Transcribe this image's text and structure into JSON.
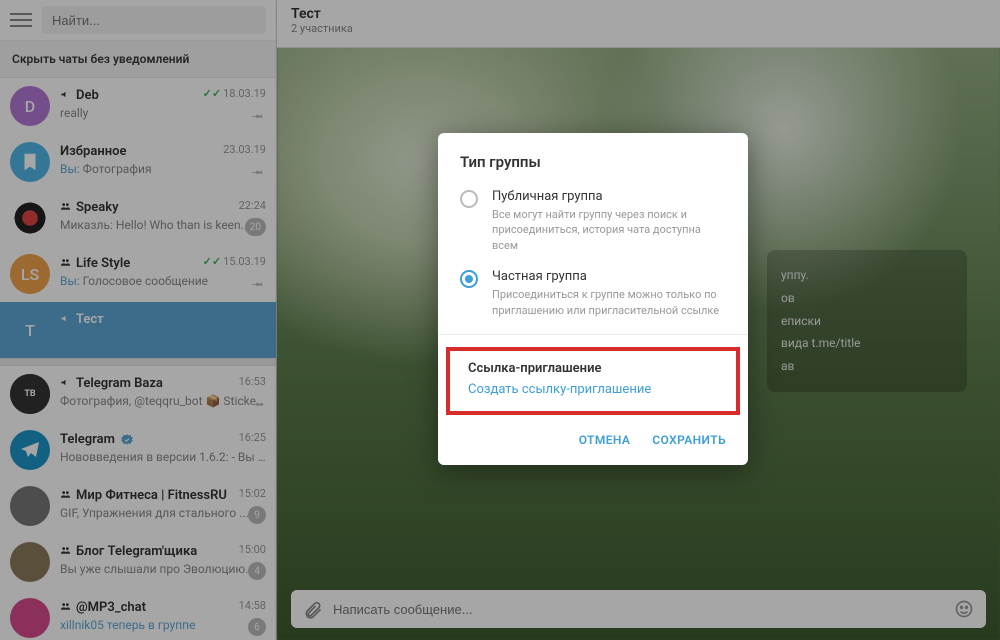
{
  "search": {
    "placeholder": "Найти..."
  },
  "hide_label": "Скрыть чаты без уведомлений",
  "chats": [
    {
      "avatar_letter": "D",
      "avatar_bg": "#b379d6",
      "speaker": true,
      "name": "Deb",
      "sub": "really",
      "time": "18.03.19",
      "checks": true,
      "pin": true
    },
    {
      "avatar_letter": "",
      "avatar_bg": "#4fb5e7",
      "speaker": false,
      "name": "Избранное",
      "sub_prefix": "Вы:",
      "sub": " Фотография",
      "time": "23.03.19",
      "pin": true,
      "saved": true
    },
    {
      "avatar_letter": "",
      "avatar_bg": "#fff",
      "speaker": true,
      "name": "Speaky",
      "sub": "Миказль: Hello! Who than is keen...",
      "time": "22:24",
      "badge": "20",
      "speaky": true
    },
    {
      "avatar_letter": "LS",
      "avatar_bg": "#f0a24c",
      "speaker": true,
      "name": "Life Style",
      "sub_prefix": "Вы:",
      "sub": " Голосовое сообщение",
      "time": "15.03.19",
      "checks": true,
      "pin": true
    },
    {
      "avatar_letter": "T",
      "avatar_bg": "#5da6d4",
      "speaker": true,
      "name": "Тест",
      "sub": "",
      "time": "",
      "selected": true
    },
    {
      "avatar_letter": "",
      "avatar_bg": "#333",
      "speaker": true,
      "name": "Telegram Baza",
      "sub": "Фотография, @teqqru_bot 📦 Sticker...",
      "time": "16:53",
      "pin": true,
      "baza": true
    },
    {
      "avatar_letter": "",
      "avatar_bg": "#1e96c8",
      "speaker": false,
      "name": "Telegram",
      "verified": true,
      "sub": "Нововведения в версии 1.6.2: - Вы м...",
      "time": "16:25",
      "tg": true
    },
    {
      "avatar_letter": "",
      "avatar_bg": "#777",
      "speaker": true,
      "name": "Мир Фитнеса | FitnessRU",
      "sub": "GIF, Упражнения для стального ...",
      "time": "15:02",
      "badge": "9"
    },
    {
      "avatar_letter": "",
      "avatar_bg": "#8a7a5a",
      "speaker": true,
      "name": "Блог Telegram'щика",
      "sub": "Вы уже слышали про Эволюцию...",
      "time": "15:00",
      "badge": "4"
    },
    {
      "avatar_letter": "",
      "avatar_bg": "#d64b8a",
      "speaker": true,
      "name": "@MP3_chat",
      "sub_prefix": "",
      "sub": "xillnik05 теперь в группе",
      "sub_blue": true,
      "time": "14:58",
      "badge": "6"
    }
  ],
  "main": {
    "title": "Тест",
    "subtitle": "2 участника",
    "sys_lines": [
      "уппу.",
      "ов",
      "еписки",
      "вида t.me/title",
      "ав"
    ],
    "compose_placeholder": "Написать сообщение..."
  },
  "modal": {
    "title": "Тип группы",
    "opt_public": {
      "title": "Публичная группа",
      "desc": "Все могут найти группу через поиск и присоединиться, история чата доступна всем"
    },
    "opt_private": {
      "title": "Частная группа",
      "desc": "Присоединиться к группе можно только по приглашению или пригласительной ссылке"
    },
    "invite_title": "Ссылка-приглашение",
    "invite_link": "Создать ссылку-приглашение",
    "cancel": "ОТМЕНА",
    "save": "СОХРАНИТЬ"
  }
}
